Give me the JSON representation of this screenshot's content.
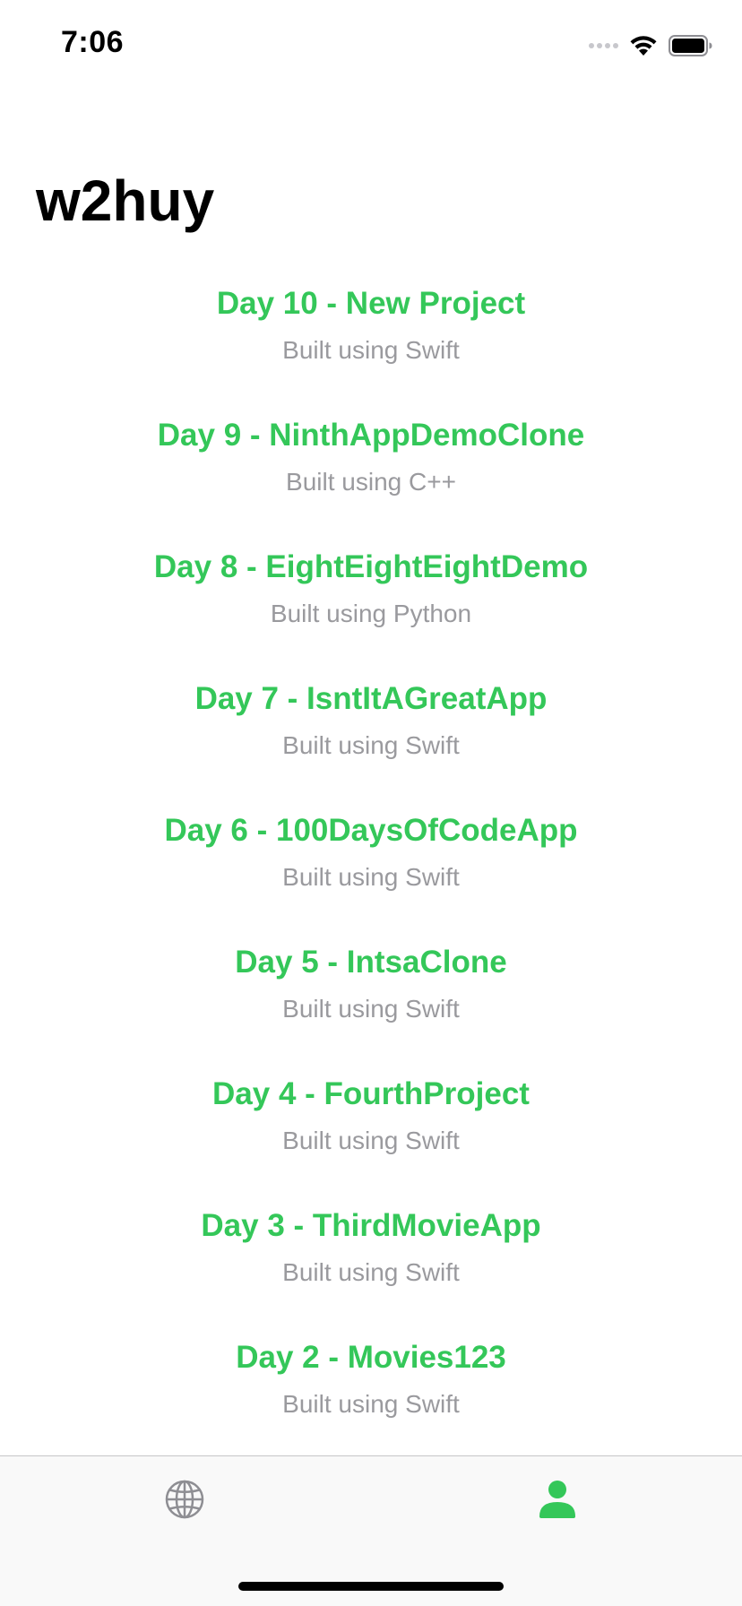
{
  "status_bar": {
    "time": "7:06",
    "icons": [
      "signal-dots-icon",
      "wifi-icon",
      "battery-icon"
    ]
  },
  "header": {
    "title": "w2huy"
  },
  "projects": [
    {
      "title": "Day 10 - New Project",
      "subtitle": "Built using Swift"
    },
    {
      "title": "Day 9 - NinthAppDemoClone",
      "subtitle": "Built using C++"
    },
    {
      "title": "Day 8 - EightEightEightDemo",
      "subtitle": "Built using Python"
    },
    {
      "title": "Day 7 - IsntItAGreatApp",
      "subtitle": "Built using Swift"
    },
    {
      "title": "Day 6 - 100DaysOfCodeApp",
      "subtitle": "Built using Swift"
    },
    {
      "title": "Day 5 - IntsaClone",
      "subtitle": "Built using Swift"
    },
    {
      "title": "Day 4 - FourthProject",
      "subtitle": "Built using Swift"
    },
    {
      "title": "Day 3 - ThirdMovieApp",
      "subtitle": "Built using Swift"
    },
    {
      "title": "Day 2 - Movies123",
      "subtitle": "Built using Swift"
    }
  ],
  "tab_bar": {
    "tabs": [
      {
        "icon": "globe-icon",
        "selected": false
      },
      {
        "icon": "person-icon",
        "selected": true
      }
    ]
  },
  "colors": {
    "accent": "#34c759",
    "subtitle": "#9a9a9e",
    "tab_inactive": "#8e8e93",
    "tab_bar_bg": "#f9f9f9"
  }
}
